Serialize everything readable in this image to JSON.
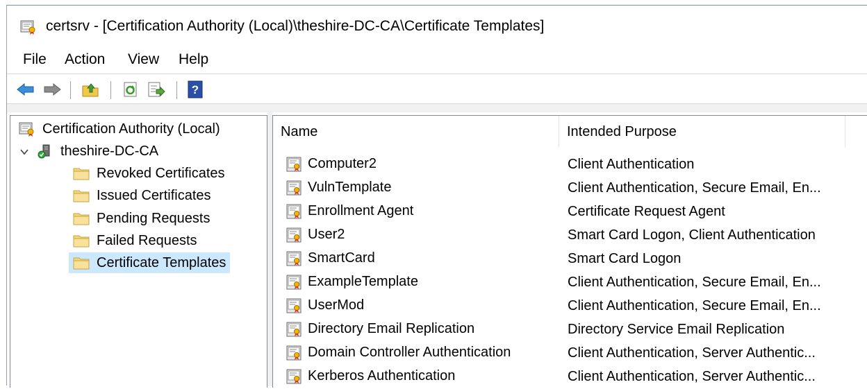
{
  "window": {
    "title": "certsrv - [Certification Authority (Local)\\theshire-DC-CA\\Certificate Templates]"
  },
  "menu": {
    "items": [
      "File",
      "Action",
      "View",
      "Help"
    ]
  },
  "toolbar": {
    "buttons": [
      "back-icon",
      "forward-icon",
      "up-folder-icon",
      "refresh-icon",
      "export-list-icon",
      "help-icon"
    ]
  },
  "tree": {
    "root": "Certification Authority (Local)",
    "ca": "theshire-DC-CA",
    "folders": [
      "Revoked Certificates",
      "Issued Certificates",
      "Pending Requests",
      "Failed Requests",
      "Certificate Templates"
    ],
    "selected": "Certificate Templates"
  },
  "list": {
    "columns": [
      "Name",
      "Intended Purpose"
    ],
    "rows": [
      {
        "name": "Computer2",
        "purpose": "Client Authentication"
      },
      {
        "name": "VulnTemplate",
        "purpose": "Client Authentication, Secure Email, En..."
      },
      {
        "name": "Enrollment Agent",
        "purpose": "Certificate Request Agent"
      },
      {
        "name": "User2",
        "purpose": "Smart Card Logon, Client Authentication"
      },
      {
        "name": "SmartCard",
        "purpose": "Smart Card Logon"
      },
      {
        "name": "ExampleTemplate",
        "purpose": "Client Authentication, Secure Email, En..."
      },
      {
        "name": "UserMod",
        "purpose": "Client Authentication, Secure Email, En..."
      },
      {
        "name": "Directory Email Replication",
        "purpose": "Directory Service Email Replication"
      },
      {
        "name": "Domain Controller Authentication",
        "purpose": "Client Authentication, Server Authentic..."
      },
      {
        "name": "Kerberos Authentication",
        "purpose": "Client Authentication, Server Authentic..."
      }
    ]
  },
  "colors": {
    "selection": "#cce8ff",
    "title_border": "#6f8fc7",
    "folder": "#f5d77a"
  }
}
